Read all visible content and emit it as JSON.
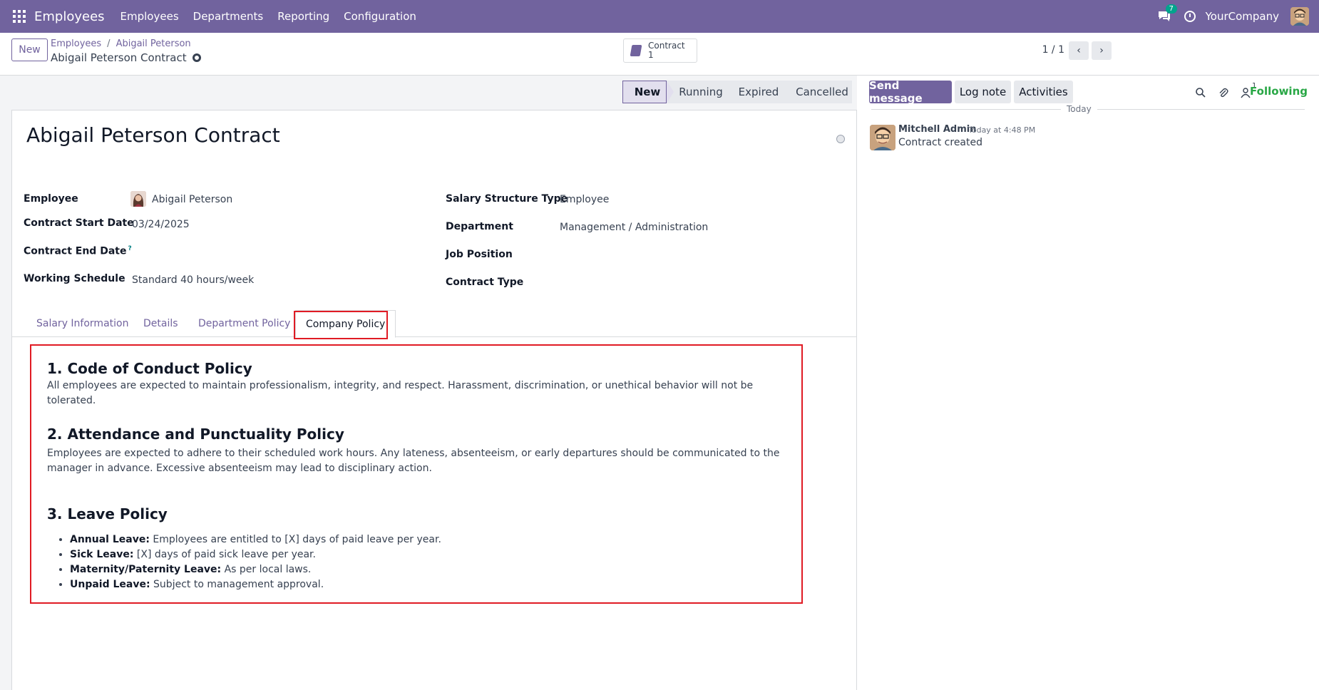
{
  "navbar": {
    "app_name": "Employees",
    "menu": [
      "Employees",
      "Departments",
      "Reporting",
      "Configuration"
    ],
    "chat_badge": "7",
    "company": "YourCompany",
    "icons": [
      "apps-grid-icon",
      "chat-icon",
      "clock-icon",
      "user-avatar"
    ]
  },
  "control_panel": {
    "new_button": "New",
    "breadcrumb": [
      "Employees",
      "Abigail Peterson"
    ],
    "breadcrumb_sep": "/",
    "record_title": "Abigail Peterson Contract",
    "smart_button": {
      "label": "Contract",
      "count": "1"
    },
    "pager": "1 / 1"
  },
  "statusbar": {
    "stages": [
      "New",
      "Running",
      "Expired",
      "Cancelled"
    ],
    "active": "New"
  },
  "form": {
    "title": "Abigail Peterson Contract",
    "left_fields": [
      {
        "label": "Employee",
        "value": "Abigail Peterson"
      },
      {
        "label": "Contract Start Date",
        "value": "03/24/2025"
      },
      {
        "label": "Contract End Date",
        "value": "",
        "help": "?"
      },
      {
        "label": "Working Schedule",
        "value": "Standard 40 hours/week"
      }
    ],
    "right_fields": [
      {
        "label": "Salary Structure Type",
        "value": "Employee"
      },
      {
        "label": "Department",
        "value": "Management / Administration"
      },
      {
        "label": "Job Position",
        "value": ""
      },
      {
        "label": "Contract Type",
        "value": ""
      }
    ],
    "tabs": [
      "Salary Information",
      "Details",
      "Department Policy",
      "Company Policy"
    ],
    "active_tab": "Company Policy"
  },
  "policy": {
    "sections": [
      {
        "heading": "1. Code of Conduct Policy",
        "text": "All employees are expected to maintain professionalism, integrity, and respect. Harassment, discrimination, or unethical behavior will not be tolerated."
      },
      {
        "heading": "2. Attendance and Punctuality Policy",
        "text": "Employees are expected to adhere to their scheduled work hours. Any lateness, absenteeism, or early departures should be communicated to the manager in advance. Excessive absenteeism may lead to disciplinary action."
      },
      {
        "heading": "3. Leave Policy",
        "items": [
          {
            "label": "Annual Leave:",
            "text": " Employees are entitled to [X] days of paid leave per year."
          },
          {
            "label": "Sick Leave:",
            "text": " [X] days of paid sick leave per year."
          },
          {
            "label": "Maternity/Paternity Leave:",
            "text": " As per local laws."
          },
          {
            "label": "Unpaid Leave:",
            "text": " Subject to management approval."
          }
        ]
      }
    ]
  },
  "chatter": {
    "send_message": "Send message",
    "log_note": "Log note",
    "activities": "Activities",
    "followers_count": "1",
    "following": "Following",
    "date_separator": "Today",
    "message": {
      "author": "Mitchell Admin",
      "time": "Today at 4:48 PM",
      "body": "Contract created"
    }
  },
  "colors": {
    "brand": "#71639e",
    "highlight": "#e01b24",
    "following": "#28a745"
  }
}
